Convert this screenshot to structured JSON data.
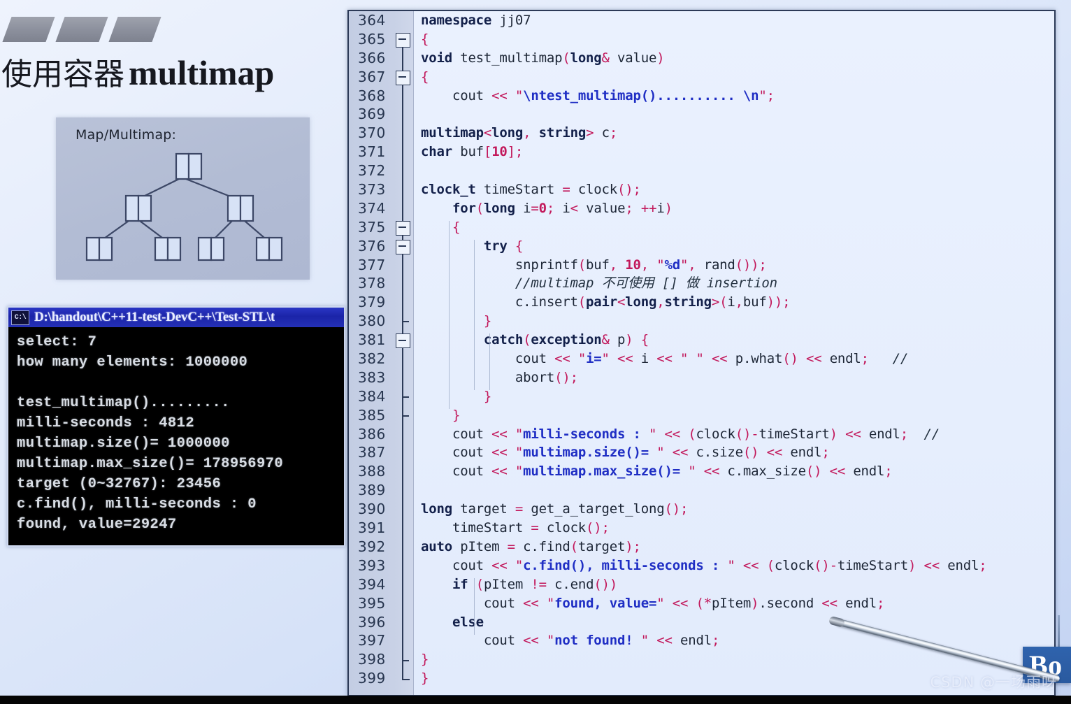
{
  "slide": {
    "title_cn": "使用容器",
    "title_en": "multimap",
    "diagram_label": "Map/Multimap:"
  },
  "console": {
    "icon": "cmd-icon",
    "title": "D:\\handout\\C++11-test-DevC++\\Test-STL\\t",
    "lines": [
      "select: 7",
      "how many elements: 1000000",
      "",
      "test_multimap().........",
      "milli-seconds : 4812",
      "multimap.size()= 1000000",
      "multimap.max_size()= 178956970",
      "target (0~32767): 23456",
      "c.find(), milli-seconds : 0",
      "found, value=29247"
    ]
  },
  "editor": {
    "first_line_number": 364,
    "line_numbers": [
      364,
      365,
      366,
      367,
      368,
      369,
      370,
      371,
      372,
      373,
      374,
      375,
      376,
      377,
      378,
      379,
      380,
      381,
      382,
      383,
      384,
      385,
      386,
      387,
      388,
      389,
      390,
      391,
      392,
      393,
      394,
      395,
      396,
      397,
      398,
      399
    ],
    "fold_boxes": [
      365,
      367,
      375,
      376,
      381
    ],
    "fold_ticks": [
      380,
      384,
      385,
      398
    ],
    "fold_end": 399,
    "code": [
      "namespace jj07",
      "{",
      "void test_multimap(long& value)",
      "{",
      "    cout << \"\\ntest_multimap().......... \\n\";",
      "",
      "multimap<long, string> c;",
      "char buf[10];",
      "",
      "clock_t timeStart = clock();",
      "    for(long i=0; i< value; ++i)",
      "    {",
      "        try {",
      "            snprintf(buf, 10, \"%d\", rand());",
      "            //multimap 不可使用 [] 做 insertion",
      "            c.insert(pair<long,string>(i,buf));",
      "        }",
      "        catch(exception& p) {",
      "            cout << \"i=\" << i << \" \" << p.what() << endl;   //",
      "            abort();",
      "        }",
      "    }",
      "    cout << \"milli-seconds : \" << (clock()-timeStart) << endl;  //",
      "    cout << \"multimap.size()= \" << c.size() << endl;",
      "    cout << \"multimap.max_size()= \" << c.max_size() << endl;",
      "",
      "long target = get_a_target_long();",
      "    timeStart = clock();",
      "auto pItem = c.find(target);",
      "    cout << \"c.find(), milli-seconds : \" << (clock()-timeStart) << endl;",
      "    if (pItem != c.end())",
      "        cout << \"found, value=\" << (*pItem).second << endl;",
      "    else",
      "        cout << \"not found! \" << endl;",
      "}",
      "}"
    ]
  },
  "badge": {
    "text": "Bo"
  },
  "watermark": {
    "text": "CSDN @一场雨呀"
  },
  "colors": {
    "slide_bg": "#dfe8fb",
    "editor_bg": "#e8f0fe",
    "gutter_bg": "#c8d1e6",
    "console_title_bg": "#2430b6",
    "keyword": "#13204a",
    "string": "#1f2ec4",
    "punct": "#c2185b",
    "comment": "#22303f",
    "badge_bg": "#2f63ad"
  }
}
